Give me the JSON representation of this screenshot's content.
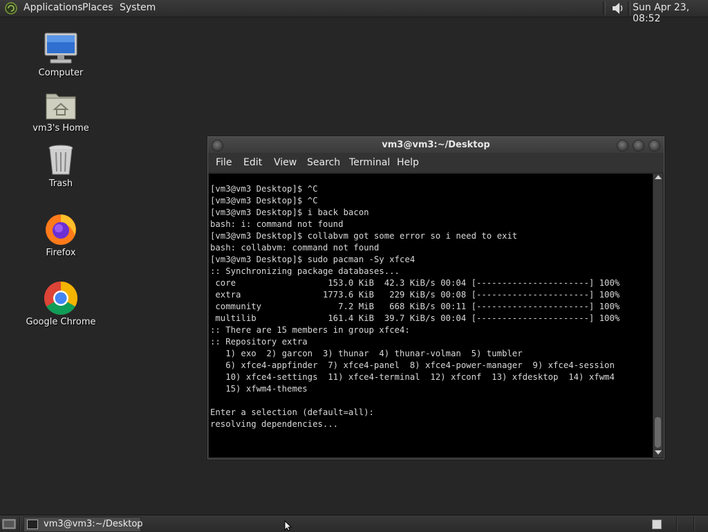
{
  "top_panel": {
    "menus": [
      "Applications",
      "Places",
      "System"
    ],
    "clock": "Sun Apr 23, 08:52"
  },
  "desktop": {
    "icons": [
      {
        "label": "Computer",
        "icon": "computer-icon"
      },
      {
        "label": "vm3's Home",
        "icon": "home-folder-icon"
      },
      {
        "label": "Trash",
        "icon": "trash-icon"
      },
      {
        "label": "Firefox",
        "icon": "firefox-icon"
      },
      {
        "label": "Google Chrome",
        "icon": "chrome-icon"
      }
    ]
  },
  "terminal": {
    "title": "vm3@vm3:~/Desktop",
    "menus": [
      "File",
      "Edit",
      "View",
      "Search",
      "Terminal",
      "Help"
    ],
    "lines": [
      "[vm3@vm3 Desktop]$ ^C",
      "[vm3@vm3 Desktop]$ ^C",
      "[vm3@vm3 Desktop]$ i back bacon",
      "bash: i: command not found",
      "[vm3@vm3 Desktop]$ collabvm got some error so i need to exit",
      "bash: collabvm: command not found",
      "[vm3@vm3 Desktop]$ sudo pacman -Sy xfce4",
      ":: Synchronizing package databases...",
      " core                  153.0 KiB  42.3 KiB/s 00:04 [----------------------] 100%",
      " extra                1773.6 KiB   229 KiB/s 00:08 [----------------------] 100%",
      " community               7.2 MiB   668 KiB/s 00:11 [----------------------] 100%",
      " multilib              161.4 KiB  39.7 KiB/s 00:04 [----------------------] 100%",
      ":: There are 15 members in group xfce4:",
      ":: Repository extra",
      "   1) exo  2) garcon  3) thunar  4) thunar-volman  5) tumbler",
      "   6) xfce4-appfinder  7) xfce4-panel  8) xfce4-power-manager  9) xfce4-session",
      "   10) xfce4-settings  11) xfce4-terminal  12) xfconf  13) xfdesktop  14) xfwm4",
      "   15) xfwm4-themes",
      "",
      "Enter a selection (default=all):",
      "resolving dependencies..."
    ]
  },
  "taskbar": {
    "tasks": [
      {
        "label": "vm3@vm3:~/Desktop",
        "icon": "terminal-icon"
      }
    ]
  }
}
